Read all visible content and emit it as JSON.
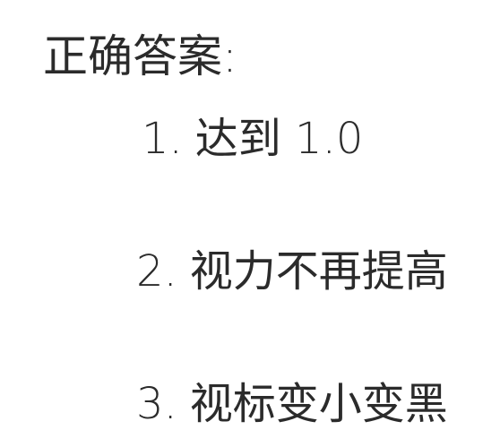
{
  "heading": "正确答案:",
  "answers": [
    {
      "number": "1.",
      "text": "达到 1.0"
    },
    {
      "number": "2.",
      "text": "视力不再提高"
    },
    {
      "number": "3.",
      "text": "视标变小变黑"
    }
  ],
  "colors": {
    "text": "#2b2b2b",
    "background": "#ffffff"
  }
}
